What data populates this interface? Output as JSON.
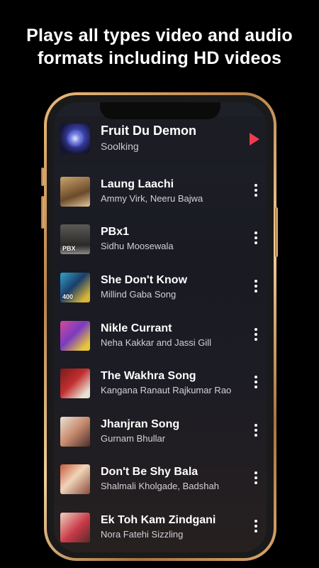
{
  "headline": {
    "line1": "Plays all types video and audio",
    "line2": "formats including HD videos"
  },
  "now_playing": {
    "title": "Fruit Du Demon",
    "artist": "Soolking",
    "play_icon": "play-icon",
    "accent_color": "#ef3b4d"
  },
  "songs": [
    {
      "title": "Laung Laachi",
      "artist": "Ammy Virk, Neeru Bajwa"
    },
    {
      "title": "PBx1",
      "artist": "Sidhu Moosewala",
      "thumb_text": "PBX"
    },
    {
      "title": "She Don't Know",
      "artist": "Millind Gaba Song",
      "thumb_text": "400"
    },
    {
      "title": "Nikle Currant",
      "artist": "Neha Kakkar and Jassi Gill"
    },
    {
      "title": "The Wakhra Song",
      "artist": "Kangana Ranaut Rajkumar Rao"
    },
    {
      "title": "Jhanjran Song",
      "artist": "Gurnam Bhullar"
    },
    {
      "title": "Don't Be Shy Bala",
      "artist": "Shalmali Kholgade, Badshah"
    },
    {
      "title": "Ek Toh Kam Zindgani",
      "artist": "Nora Fatehi Sizzling"
    }
  ]
}
